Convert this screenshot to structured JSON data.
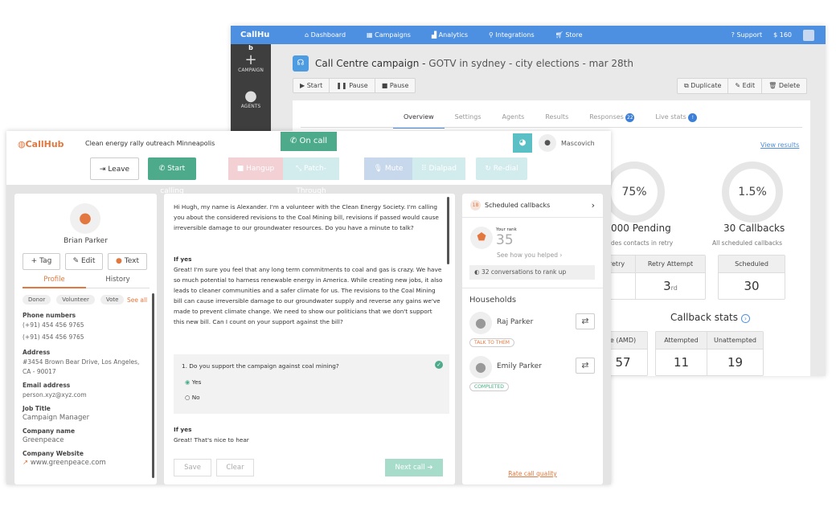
{
  "back": {
    "logo": "CallHu",
    "logo_b": "b",
    "nav": [
      {
        "icon": "home-icon",
        "label": "Dashboard"
      },
      {
        "icon": "grid-icon",
        "label": "Campaigns"
      },
      {
        "icon": "chart-icon",
        "label": "Analytics"
      },
      {
        "icon": "plug-icon",
        "label": "Integrations"
      },
      {
        "icon": "cart-icon",
        "label": "Store"
      }
    ],
    "support": "Support",
    "balance": "$ 160",
    "sidebar": [
      {
        "icon": "plus-icon",
        "label": "CAMPAIGN"
      },
      {
        "icon": "user-icon",
        "label": "AGENTS"
      }
    ],
    "title_bold": "Call Centre campaign - ",
    "title_rest": "GOTV in sydney - city elections - mar 28th",
    "actions_left": [
      "▶ Start",
      "❚❚ Pause",
      "■ Pause"
    ],
    "actions_right": [
      "Duplicate",
      "Edit",
      "Delete"
    ],
    "tabs": [
      {
        "label": "Overview",
        "active": true
      },
      {
        "label": "Settings"
      },
      {
        "label": "Agents"
      },
      {
        "label": "Results"
      },
      {
        "label": "Responses",
        "badge": "22"
      },
      {
        "label": "Live stats",
        "badge": "!"
      }
    ],
    "view_results": "View results",
    "ring1": "75%",
    "ring1_title": "000 Pending",
    "ring1_sub": "des contacts in retry",
    "ring2": "1.5%",
    "ring2_title": "30 Callbacks",
    "ring2_sub": "All scheduled callbacks",
    "retry_h1": "retry",
    "retry_h2": "Retry Attempt",
    "retry_v2": "3",
    "retry_v2_suffix": "rd",
    "sched_h": "Scheduled",
    "sched_v": "30",
    "callback_stats": "Callback stats",
    "amd_h": "e (AMD)",
    "amd_v": "57",
    "att_h": "Attempted",
    "att_v": "11",
    "unatt_h": "Unattempted",
    "unatt_v": "19"
  },
  "front": {
    "logo": "CallHub",
    "campaign": "Clean energy rally outreach Minneapolis",
    "on_call": "On call",
    "user": "Mascovich",
    "buttons": {
      "leave": "Leave",
      "start": "Start calling",
      "hangup": "Hangup",
      "patch": "Patch-Through",
      "mute": "Mute",
      "dialpad": "Dialpad",
      "redial": "Re-dial"
    },
    "contact": {
      "name": "Brian Parker",
      "tag": "Tag",
      "edit": "Edit",
      "text": "Text",
      "tab_profile": "Profile",
      "tab_history": "History",
      "chips": [
        "Donor",
        "Volunteer",
        "Vote"
      ],
      "see_all": "See all",
      "fields": [
        {
          "label": "Phone numbers",
          "values": [
            "(+91) 454 456 9765",
            "(+91) 454 456 9765"
          ]
        },
        {
          "label": "Address",
          "values": [
            "#3454 Brown Bear Drive, Los Angeles,",
            "CA - 90017"
          ]
        },
        {
          "label": "Email address",
          "values": [
            "person.xyz@xyz.com"
          ]
        },
        {
          "label": "Job Title",
          "values": [
            "Campaign Manager"
          ]
        },
        {
          "label": "Company name",
          "values": [
            "Greenpeace"
          ]
        },
        {
          "label": "Company Website",
          "values": [
            "www.greenpeace.com"
          ]
        }
      ]
    },
    "script": {
      "intro": "Hi Hugh, my name is Alexander. I'm a volunteer with the Clean Energy Society. I'm calling you about the considered revisions to the Coal Mining bill, revisions if passed would cause irreversible damage to our groundwater resources. Do you have a minute to talk?",
      "if1": "If yes",
      "p1": "Great! I'm sure you feel that any long term commitments to coal and gas is crazy. We have so much potential to harness renewable energy in America. While creating new jobs, it also leads to cleaner communities and a safer climate for us. The revisions to the Coal Mining bill can cause irreversible damage to our groundwater supply and reverse any gains we've made to prevent climate change. We need to show our politicians that we don't support this new bill. Can I count on your support against the bill?",
      "question": "1. Do you support the campaign against coal mining?",
      "options": [
        {
          "label": "Yes",
          "selected": true
        },
        {
          "label": "No",
          "selected": false
        }
      ],
      "if2": "If yes",
      "p2": "Great! That's nice to hear",
      "save": "Save",
      "clear": "Clear",
      "next": "Next call"
    },
    "side": {
      "callbacks_count": "18",
      "callbacks": "Scheduled callbacks",
      "rank_label": "Your rank",
      "rank": "35",
      "helped": "See how you helped",
      "rank_up": "32 conversations to rank up",
      "households": "Households",
      "members": [
        {
          "name": "Raj Parker",
          "status": "TALK TO THEM",
          "color": "#e2783f"
        },
        {
          "name": "Emily Parker",
          "status": "COMPLETED",
          "color": "#3fb07f"
        }
      ],
      "rate": "Rate call quality"
    }
  },
  "colors": {
    "brand": "#e2783f",
    "nav": "#4d8fe0",
    "green": "#4dab8c"
  }
}
